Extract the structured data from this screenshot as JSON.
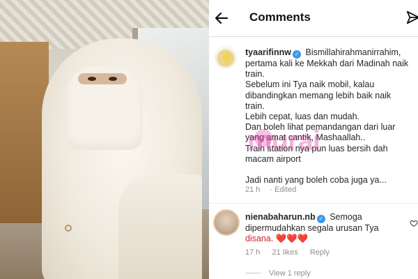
{
  "header": {
    "title": "Comments"
  },
  "comments": [
    {
      "username": "tyaarifinnw",
      "lines": [
        "Bismillahirahmanirrahim,",
        "pertama kali ke Mekkah dari Madinah naik",
        "train.",
        "Sebelum ini Tya naik mobil, kalau",
        "dibandingkan memang lebih baik naik",
        "train.",
        "Lebih cepat, luas dan mudah.",
        "Dan boleh lihat pemandangan dari luar",
        "yang amat cantik, Mashaallah..",
        "Train station nya pun luas bersih dah",
        "macam airport",
        "",
        "Jadi nanti yang boleh coba juga ya..."
      ],
      "time": "21 h",
      "edited": "Edited"
    },
    {
      "username": "nienabaharun.nb",
      "lines": [
        "Semoga",
        "dipermudahkan segala urusan Tya",
        "disana. ❤️❤️❤️"
      ],
      "time": "17 h",
      "likes": "21 likes",
      "reply": "Reply",
      "view_replies": "View 1 reply"
    }
  ],
  "watermark": "murai",
  "icons": {
    "back": "back-arrow-icon",
    "send": "send-icon",
    "verified": "verified-badge-icon",
    "like": "heart-outline-icon"
  },
  "colors": {
    "verified": "#3897f0",
    "meta_text": "#8e8e8e",
    "watermark": "#dc28a0"
  }
}
